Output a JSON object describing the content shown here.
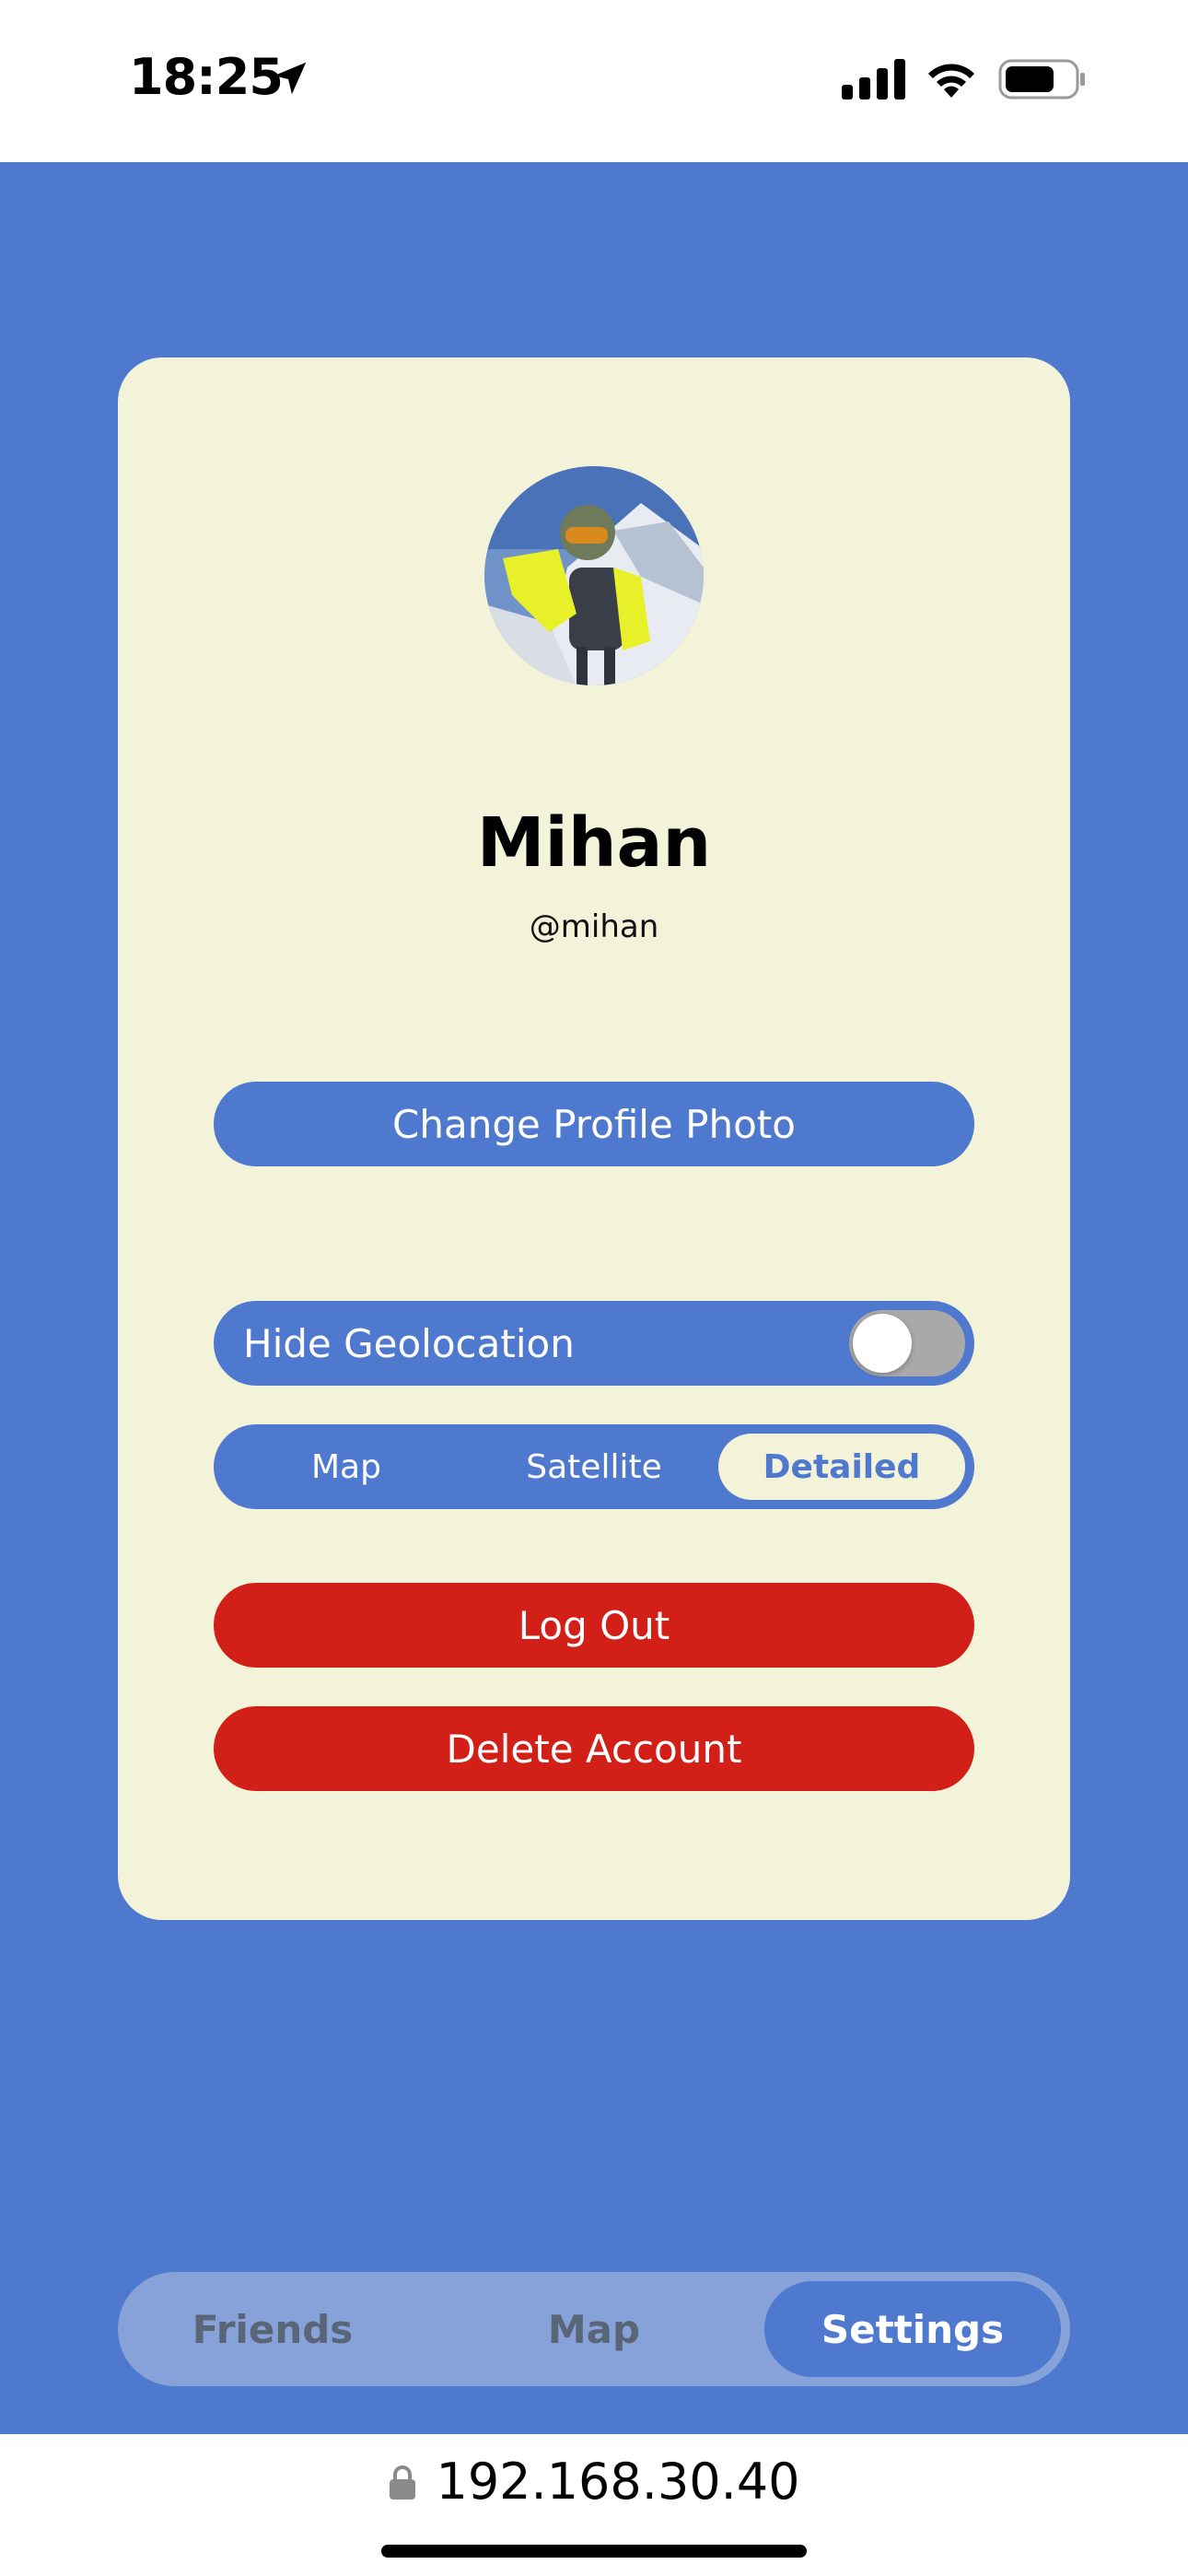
{
  "status_bar": {
    "time": "18:25"
  },
  "profile": {
    "name": "Mihan",
    "handle": "@mihan",
    "avatar_description_icon": "avatar-photo"
  },
  "actions": {
    "change_photo_label": "Change Profile Photo",
    "hide_geolocation_label": "Hide Geolocation",
    "hide_geolocation_on": false,
    "logout_label": "Log Out",
    "delete_label": "Delete Account"
  },
  "map_style": {
    "options": [
      "Map",
      "Satellite",
      "Detailed"
    ],
    "selected": "Detailed"
  },
  "tabs": {
    "items": [
      "Friends",
      "Map",
      "Settings"
    ],
    "active": "Settings"
  },
  "browser": {
    "url": "192.168.30.40"
  },
  "colors": {
    "primary_blue": "#4f79cf",
    "card_cream": "#f3f3da",
    "danger_red": "#d21f17",
    "tabbar_light": "#86a2d8"
  }
}
